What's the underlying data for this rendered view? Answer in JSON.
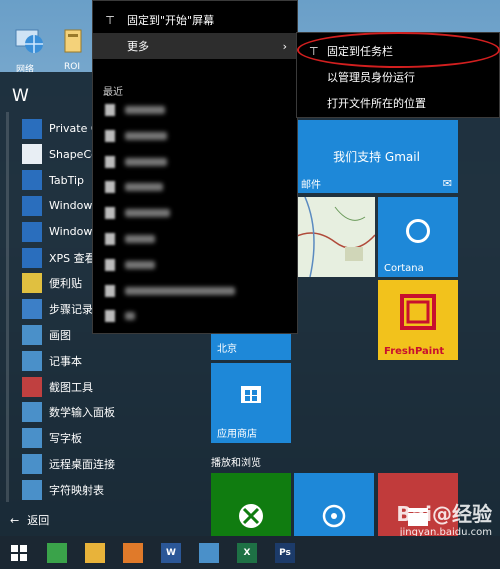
{
  "desktop": {
    "icons": [
      {
        "name": "network",
        "label": "网络"
      },
      {
        "name": "file",
        "label": "ROI"
      }
    ]
  },
  "start_menu": {
    "letter": "W",
    "apps": [
      {
        "label": "Private C",
        "icon": "private-icon",
        "color": "#2a6ebd"
      },
      {
        "label": "ShapeCo",
        "icon": "shapecollector-icon",
        "color": "#e8eef4"
      },
      {
        "label": "TabTip",
        "icon": "tabtip-icon",
        "color": "#2a6ebd"
      },
      {
        "label": "Windows",
        "icon": "windows-app-icon",
        "color": "#2a6ebd"
      },
      {
        "label": "Windows",
        "icon": "windows-app-icon",
        "color": "#2a6ebd"
      },
      {
        "label": "XPS 查看",
        "icon": "xps-icon",
        "color": "#2a6ebd"
      },
      {
        "label": "便利贴",
        "icon": "sticky-notes-icon",
        "color": "#e0c040"
      },
      {
        "label": "步骤记录",
        "icon": "steps-recorder-icon",
        "color": "#3c7fc7"
      },
      {
        "label": "画图",
        "icon": "paint-icon",
        "color": "#4a90c9"
      },
      {
        "label": "记事本",
        "icon": "notepad-icon",
        "color": "#4a90c9"
      },
      {
        "label": "截图工具",
        "icon": "snipping-tool-icon",
        "color": "#c04040"
      },
      {
        "label": "数学输入面板",
        "icon": "math-panel-icon",
        "color": "#4a90c9"
      },
      {
        "label": "写字板",
        "icon": "wordpad-icon",
        "color": "#4a90c9"
      },
      {
        "label": "远程桌面连接",
        "icon": "remote-desktop-icon",
        "color": "#4a90c9"
      },
      {
        "label": "字符映射表",
        "icon": "charmap-icon",
        "color": "#4a90c9"
      }
    ],
    "back_label": "返回",
    "tiles": {
      "gmail": "我们支持 Gmail",
      "mail": "邮件",
      "cortana": "Cortana",
      "freshpaint": "FreshPaint",
      "weather_city": "北京",
      "store": "应用商店",
      "group_play": "播放和浏览"
    }
  },
  "context_menu": {
    "pin_start": "固定到\"开始\"屏幕",
    "more": "更多",
    "recent_header": "最近"
  },
  "submenu": {
    "pin_taskbar": "固定到任务栏",
    "run_as_admin": "以管理员身份运行",
    "open_location": "打开文件所在的位置"
  },
  "taskbar": {
    "apps": [
      {
        "name": "360-browser-icon",
        "color": "#3aa34a",
        "text": ""
      },
      {
        "name": "file-explorer-icon",
        "color": "#e8b33a",
        "text": ""
      },
      {
        "name": "foxit-icon",
        "color": "#e07a2a",
        "text": ""
      },
      {
        "name": "word-icon",
        "color": "#2b5797",
        "text": "W"
      },
      {
        "name": "control-panel-icon",
        "color": "#4a90c9",
        "text": ""
      },
      {
        "name": "excel-icon",
        "color": "#1e7145",
        "text": "X"
      },
      {
        "name": "photoshop-icon",
        "color": "#1c3b6a",
        "text": "Ps"
      }
    ]
  },
  "watermark": {
    "main": "Bai@经验",
    "sub": "jingyan.baidu.com"
  },
  "colors": {
    "accent_blue": "#1e88d8",
    "highlight_red": "#d21f1f",
    "freshpaint_yellow": "#f2c21c",
    "xbox_green": "#107c10"
  }
}
